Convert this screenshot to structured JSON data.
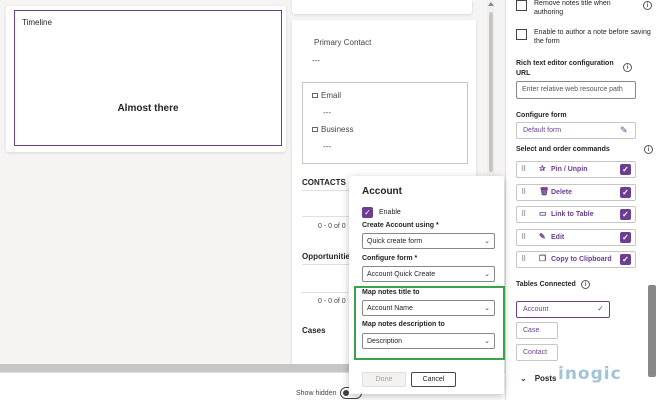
{
  "canvas": {
    "timeline_label": "Timeline",
    "timeline_status": "Almost there",
    "primary_contact_label": "Primary Contact",
    "primary_contact_value": "---",
    "quick_view": {
      "email_label": "Email",
      "email_value": "---",
      "business_label": "Business",
      "business_value": "---"
    },
    "contacts_label": "CONTACTS",
    "contacts_count": "0 - 0 of 0",
    "opportunities_label": "Opportunities",
    "opportunities_count": "0 - 0 of 0",
    "cases_label": "Cases",
    "show_hidden_label": "Show hidden"
  },
  "panel": {
    "remove_notes_title": "Remove notes title when authoring",
    "enable_author_note": "Enable to author a note before saving the form",
    "rich_text_label": "Rich text editor configuration URL",
    "rich_text_placeholder": "Enter relative web resource path",
    "configure_form_label": "Configure form",
    "configure_form_value": "Default form",
    "commands_label": "Select and order commands",
    "commands": [
      {
        "label": "Pin / Unpin",
        "icon": "pin-icon",
        "glyph": "✰",
        "checked": true
      },
      {
        "label": "Delete",
        "icon": "trash-icon",
        "glyph": "🗑",
        "checked": true
      },
      {
        "label": "Link to Table",
        "icon": "document-icon",
        "glyph": "▭",
        "checked": true
      },
      {
        "label": "Edit",
        "icon": "pencil-icon",
        "glyph": "✎",
        "checked": true
      },
      {
        "label": "Copy to Clipboard",
        "icon": "copy-icon",
        "glyph": "❐",
        "checked": true
      }
    ],
    "tables_label": "Tables Connected",
    "tables": [
      {
        "label": "Account",
        "selected": true
      },
      {
        "label": "Case",
        "selected": false
      },
      {
        "label": "Contact",
        "selected": false
      }
    ],
    "posts_label": "Posts"
  },
  "dialog": {
    "title": "Account",
    "enable_label": "Enable",
    "create_using_label": "Create Account using *",
    "create_using_value": "Quick create form",
    "configure_form_label": "Configure form *",
    "configure_form_value": "Account Quick Create",
    "map_title_label": "Map notes title to",
    "map_title_value": "Account Name",
    "map_desc_label": "Map notes description to",
    "map_desc_value": "Description",
    "done_label": "Done",
    "cancel_label": "Cancel"
  },
  "logo": "inogic",
  "colors": {
    "accent": "#6b3e92",
    "highlight_border": "#3aa34a"
  }
}
